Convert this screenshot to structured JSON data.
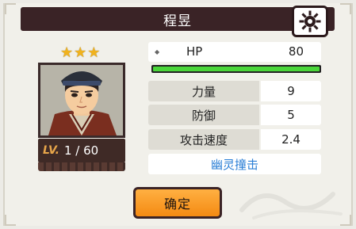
{
  "dialog": {
    "title": "程昱",
    "settings_icon": "gear-icon",
    "confirm_label": "确定"
  },
  "character": {
    "stars": 3,
    "star_symbol": "★",
    "level_label": "LV.",
    "level_value": "1 / 60"
  },
  "stats": {
    "hp_label": "HP",
    "hp_value": "80",
    "hp_fill_fraction": 1.0,
    "rows": [
      {
        "name": "力量",
        "value": "9"
      },
      {
        "name": "防御",
        "value": "5"
      },
      {
        "name": "攻击速度",
        "value": "2.4"
      }
    ],
    "skill": "幽灵撞击"
  },
  "colors": {
    "title_bar": "#3a2326",
    "hp_fill": "#4ad63a",
    "skill_text": "#2b7fd6",
    "button": "#f48a12"
  }
}
